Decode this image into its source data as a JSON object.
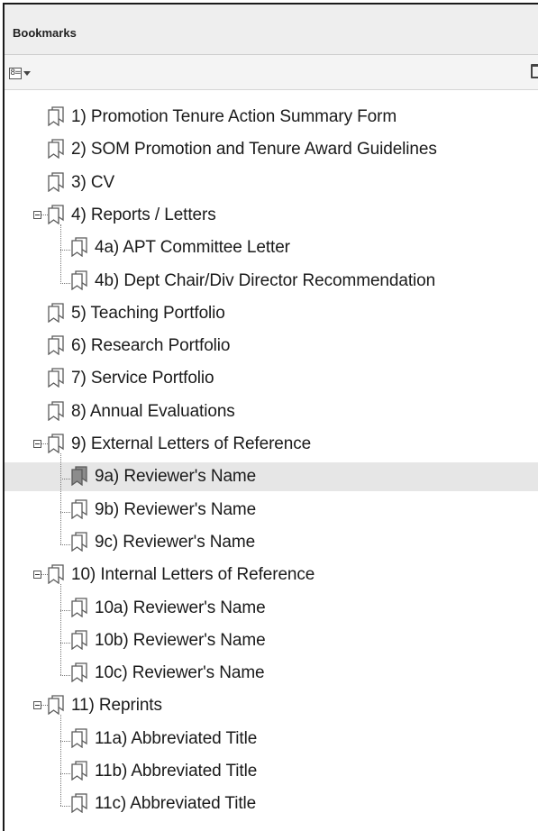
{
  "panel": {
    "title": "Bookmarks"
  },
  "toolbar": {
    "options_glyph": "8=",
    "options_icon": "options-menu-icon",
    "delete_icon": "trash-icon"
  },
  "bookmarks": [
    {
      "id": "b1",
      "label": "1) Promotion Tenure Action Summary Form"
    },
    {
      "id": "b2",
      "label": "2) SOM Promotion and Tenure Award Guidelines"
    },
    {
      "id": "b3",
      "label": "3) CV"
    },
    {
      "id": "b4",
      "label": "4) Reports / Letters",
      "expanded": true,
      "children": [
        {
          "id": "b4a",
          "label": "4a) APT Committee Letter"
        },
        {
          "id": "b4b",
          "label": "4b) Dept Chair/Div Director Recommendation"
        }
      ]
    },
    {
      "id": "b5",
      "label": "5) Teaching Portfolio"
    },
    {
      "id": "b6",
      "label": "6) Research Portfolio"
    },
    {
      "id": "b7",
      "label": "7) Service Portfolio"
    },
    {
      "id": "b8",
      "label": "8) Annual Evaluations"
    },
    {
      "id": "b9",
      "label": "9) External Letters of Reference",
      "expanded": true,
      "children": [
        {
          "id": "b9a",
          "label": "9a) Reviewer's Name",
          "selected": true
        },
        {
          "id": "b9b",
          "label": "9b) Reviewer's Name"
        },
        {
          "id": "b9c",
          "label": "9c) Reviewer's Name"
        }
      ]
    },
    {
      "id": "b10",
      "label": "10) Internal Letters of Reference",
      "expanded": true,
      "children": [
        {
          "id": "b10a",
          "label": "10a) Reviewer's Name"
        },
        {
          "id": "b10b",
          "label": "10b) Reviewer's Name"
        },
        {
          "id": "b10c",
          "label": "10c) Reviewer's Name"
        }
      ]
    },
    {
      "id": "b11",
      "label": "11) Reprints",
      "expanded": true,
      "children": [
        {
          "id": "b11a",
          "label": "11a) Abbreviated Title"
        },
        {
          "id": "b11b",
          "label": "11b) Abbreviated Title"
        },
        {
          "id": "b11c",
          "label": "11c) Abbreviated Title"
        }
      ]
    }
  ],
  "colors": {
    "selected_row": "#e6e6e6",
    "header_bg": "#eeeeee",
    "icon_stroke": "#5a5a5a",
    "icon_fill": "#ffffff",
    "selected_icon_fill": "#8c8c8c"
  }
}
